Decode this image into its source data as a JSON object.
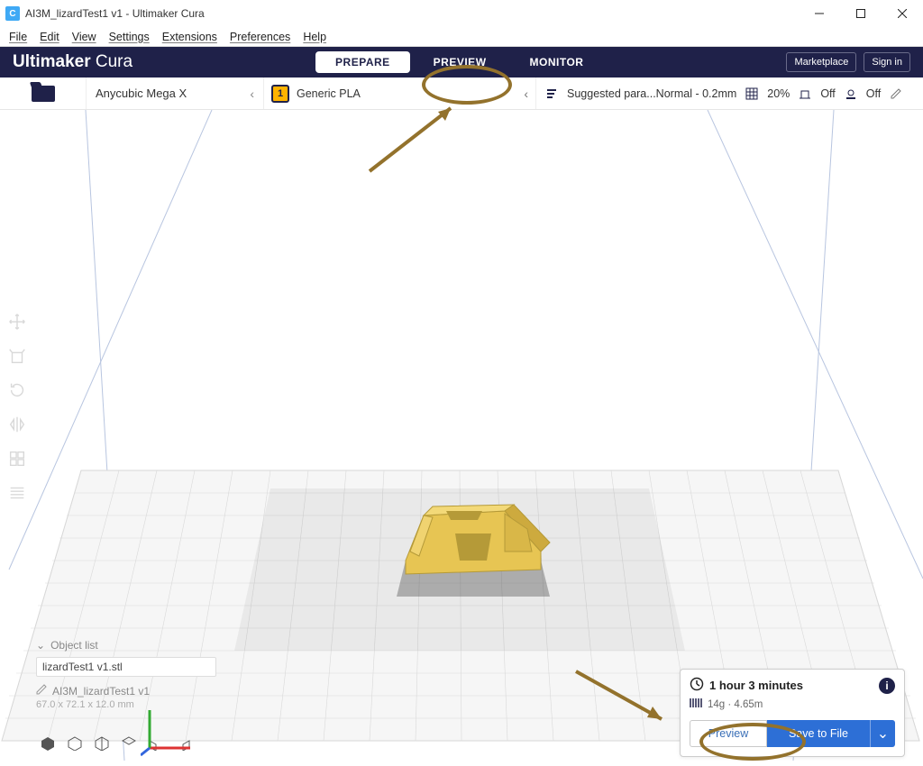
{
  "window": {
    "title": "AI3M_lizardTest1 v1 - Ultimaker Cura",
    "app_badge": "C"
  },
  "menu": {
    "file": "File",
    "edit": "Edit",
    "view": "View",
    "settings": "Settings",
    "extensions": "Extensions",
    "preferences": "Preferences",
    "help": "Help"
  },
  "header": {
    "brand_bold": "Ultimaker",
    "brand_light": "Cura",
    "tabs": {
      "prepare": "PREPARE",
      "preview": "PREVIEW",
      "monitor": "MONITOR"
    },
    "marketplace": "Marketplace",
    "signin": "Sign in"
  },
  "settings_row": {
    "printer": "Anycubic Mega X",
    "extruder_badge": "1",
    "material": "Generic PLA",
    "profile_text": "Suggested para...Normal - 0.2mm",
    "infill": "20%",
    "support": "Off",
    "adhesion": "Off"
  },
  "toolbar": {
    "items": [
      "move",
      "scale",
      "rotate",
      "mirror",
      "per-model",
      "support-blocker"
    ]
  },
  "object_list": {
    "header": "Object list",
    "file": "lizardTest1 v1.stl",
    "model": "AI3M_lizardTest1 v1",
    "dims": "67.0 x 72.1 x 12.0 mm"
  },
  "action_panel": {
    "time": "1 hour 3 minutes",
    "material": "14g · 4.65m",
    "preview": "Preview",
    "save": "Save to File"
  },
  "icons": {
    "clock": "clock-icon",
    "info": "i",
    "lines": "material-lines-icon"
  }
}
